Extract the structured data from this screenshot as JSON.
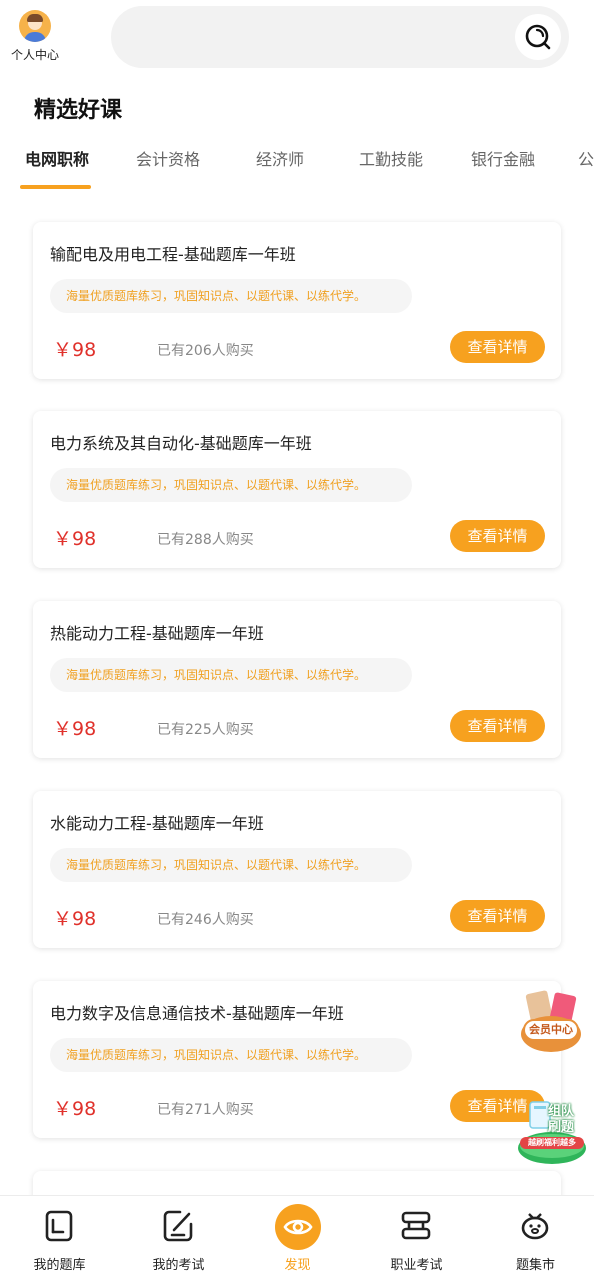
{
  "header": {
    "profile_label": "个人中心",
    "search_placeholder": ""
  },
  "section_title": "精选好课",
  "tabs": [
    {
      "label": "电网职称",
      "active": true
    },
    {
      "label": "会计资格",
      "active": false
    },
    {
      "label": "经济师",
      "active": false
    },
    {
      "label": "工勤技能",
      "active": false
    },
    {
      "label": "银行金融",
      "active": false
    },
    {
      "label": "公",
      "active": false
    }
  ],
  "courses": [
    {
      "title": "输配电及用电工程-基础题库一年班",
      "tag": "海量优质题库练习，巩固知识点、以题代课、以练代学。",
      "price": "￥98",
      "sold": "已有206人购买",
      "button": "查看详情"
    },
    {
      "title": "电力系统及其自动化-基础题库一年班",
      "tag": "海量优质题库练习，巩固知识点、以题代课、以练代学。",
      "price": "￥98",
      "sold": "已有288人购买",
      "button": "查看详情"
    },
    {
      "title": "热能动力工程-基础题库一年班",
      "tag": "海量优质题库练习，巩固知识点、以题代课、以练代学。",
      "price": "￥98",
      "sold": "已有225人购买",
      "button": "查看详情"
    },
    {
      "title": "水能动力工程-基础题库一年班",
      "tag": "海量优质题库练习，巩固知识点、以题代课、以练代学。",
      "price": "￥98",
      "sold": "已有246人购买",
      "button": "查看详情"
    },
    {
      "title": "电力数字及信息通信技术-基础题库一年班",
      "tag": "海量优质题库练习，巩固知识点、以题代课、以练代学。",
      "price": "￥98",
      "sold": "已有271人购买",
      "button": "查看详情"
    }
  ],
  "floating": {
    "member_label": "会员中心",
    "team_label_1": "组队",
    "team_label_2": "刷题",
    "team_sub": "越刷福利越多"
  },
  "bottom_nav": [
    {
      "label": "我的题库",
      "icon": "book-icon",
      "active": false
    },
    {
      "label": "我的考试",
      "icon": "edit-icon",
      "active": false
    },
    {
      "label": "发现",
      "icon": "eye-icon",
      "active": true
    },
    {
      "label": "职业考试",
      "icon": "stack-icon",
      "active": false
    },
    {
      "label": "题集市",
      "icon": "piggy-icon",
      "active": false
    }
  ],
  "colors": {
    "accent": "#f7a11f",
    "price": "#e0312b",
    "tag_text": "#f0a020"
  }
}
